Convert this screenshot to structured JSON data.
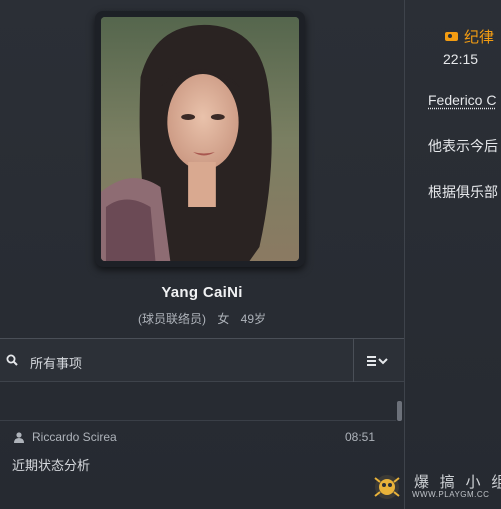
{
  "profile": {
    "name": "Yang CaiNi",
    "role": "(球员联络员)",
    "gender": "女",
    "age": "49岁"
  },
  "search": {
    "label": "所有事项"
  },
  "list": {
    "items": [
      {
        "user": "Riccardo Scirea",
        "time": "08:51",
        "title": "近期状态分析"
      }
    ]
  },
  "detail": {
    "tag": "纪律",
    "time": "22:15",
    "link_text": "Federico C",
    "line1": "他表示今后",
    "line2": "根据俱乐部"
  },
  "watermark": {
    "text": "爆 搞 小 组",
    "sub": "WWW.PLAYGM.CC"
  },
  "colors": {
    "accent": "#f39c12",
    "background": "#2a2e35"
  }
}
